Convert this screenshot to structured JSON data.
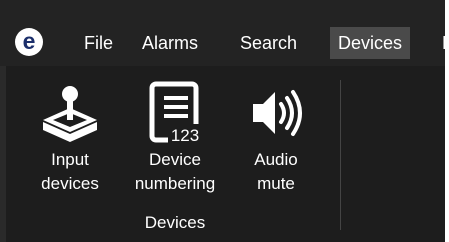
{
  "menubar": {
    "logo_letter": "e",
    "items": [
      {
        "label": "File"
      },
      {
        "label": "Alarms"
      },
      {
        "label": "Search"
      },
      {
        "label": "Devices",
        "active": true
      },
      {
        "label": "F"
      }
    ]
  },
  "ribbon": {
    "buttons": [
      {
        "label_line1": "Input",
        "label_line2": "devices",
        "icon": "joystick-icon"
      },
      {
        "label_line1": "Device",
        "label_line2": "numbering",
        "icon": "list-numbering-icon",
        "icon_text": "123"
      },
      {
        "label_line1": "Audio",
        "label_line2": "mute",
        "icon": "speaker-icon"
      }
    ],
    "group_label": "Devices"
  },
  "colors": {
    "background": "#1f1f1f",
    "active_menu": "#4a4a4a",
    "text": "#ffffff",
    "logo_fg": "#1c2f6b"
  }
}
